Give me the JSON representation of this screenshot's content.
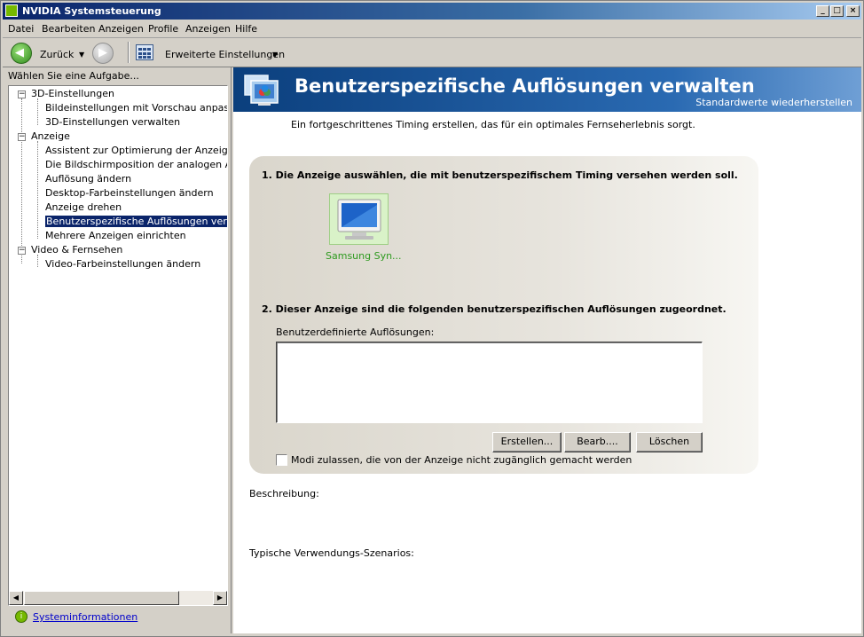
{
  "window": {
    "title": "NVIDIA Systemsteuerung"
  },
  "menu": [
    "Datei",
    "Bearbeiten",
    "Anzeigen",
    "Profile",
    "Anzeigen",
    "Hilfe"
  ],
  "toolbar": {
    "back_label": "Zurück",
    "advanced_label": "Erweiterte Einstellungen"
  },
  "left": {
    "title": "Wählen Sie eine Aufgabe...",
    "tree": [
      {
        "label": "3D-Einstellungen",
        "level": 0
      },
      {
        "label": "Bildeinstellungen mit Vorschau anpassen",
        "level": 1
      },
      {
        "label": "3D-Einstellungen verwalten",
        "level": 1
      },
      {
        "label": "Anzeige",
        "level": 0
      },
      {
        "label": "Assistent zur Optimierung der Anzeige ausf",
        "level": 1
      },
      {
        "label": "Die Bildschirmposition der analogen Anzeige",
        "level": 1
      },
      {
        "label": "Auflösung ändern",
        "level": 1
      },
      {
        "label": "Desktop-Farbeinstellungen ändern",
        "level": 1
      },
      {
        "label": "Anzeige drehen",
        "level": 1
      },
      {
        "label": "Benutzerspezifische Auflösungen verwalte",
        "level": 1,
        "selected": true
      },
      {
        "label": "Mehrere Anzeigen einrichten",
        "level": 1
      },
      {
        "label": "Video & Fernsehen",
        "level": 0
      },
      {
        "label": "Video-Farbeinstellungen ändern",
        "level": 1
      }
    ],
    "sysinfo_link": "Systeminformationen"
  },
  "main": {
    "header_title": "Benutzerspezifische Auflösungen verwalten",
    "restore_link": "Standardwerte wiederherstellen",
    "intro": "Ein fortgeschrittenes Timing erstellen, das für ein optimales Fernseherlebnis sorgt.",
    "step1": "1. Die Anzeige auswählen, die mit benutzerspezifischem Timing versehen werden soll.",
    "monitor_label": "Samsung Syn...",
    "step2": "2. Dieser Anzeige sind die folgenden benutzerspezifischen Auflösungen zugeordnet.",
    "custom_res_label": "Benutzerdefinierte Auflösungen:",
    "buttons": {
      "create": "Erstellen...",
      "edit": "Bearb....",
      "delete": "Löschen"
    },
    "checkbox_label": "Modi zulassen, die von der Anzeige nicht zugänglich gemacht werden",
    "description_label": "Beschreibung:",
    "scenarios_label": "Typische Verwendungs-Szenarios:"
  },
  "colors": {
    "header_blue": "#0b3f7d",
    "selection": "#0a246a",
    "nvidia_green": "#76b900",
    "monitor_label": "#2e9a1f"
  }
}
